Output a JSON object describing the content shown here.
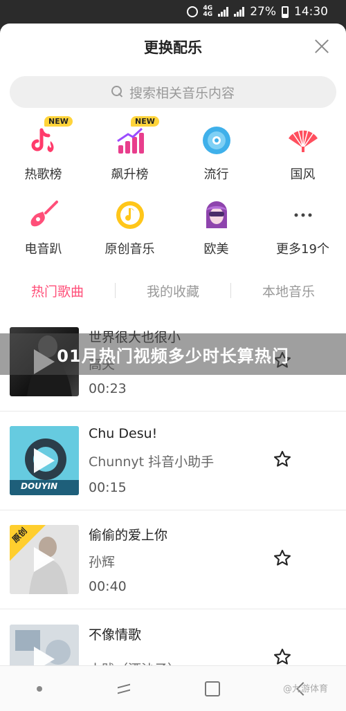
{
  "status_bar": {
    "net1": "4G",
    "net2": "4G",
    "battery": "27%",
    "time": "14:30"
  },
  "header": {
    "title": "更换配乐"
  },
  "search": {
    "placeholder": "搜索相关音乐内容"
  },
  "categories": [
    {
      "label": "热歌榜",
      "icon": "tiktok-fire-icon",
      "badge": "NEW"
    },
    {
      "label": "飙升榜",
      "icon": "trending-bars-icon",
      "badge": "NEW"
    },
    {
      "label": "流行",
      "icon": "vinyl-disc-icon"
    },
    {
      "label": "国风",
      "icon": "folding-fan-icon"
    },
    {
      "label": "电音趴",
      "icon": "electric-guitar-icon"
    },
    {
      "label": "原创音乐",
      "icon": "music-note-disc-icon"
    },
    {
      "label": "欧美",
      "icon": "avatar-sunglasses-icon"
    },
    {
      "label": "更多19个",
      "icon": "more-dots-icon"
    }
  ],
  "tabs": [
    {
      "label": "热门歌曲",
      "active": true
    },
    {
      "label": "我的收藏",
      "active": false
    },
    {
      "label": "本地音乐",
      "active": false
    }
  ],
  "songs": [
    {
      "name": "世界很大也很小",
      "artist": "高夫",
      "duration": "00:23"
    },
    {
      "name": "Chu Desu!",
      "artist": "Chunnyt 抖音小助手",
      "duration": "00:15",
      "cover_text": "DOUYIN"
    },
    {
      "name": "偷偷的爱上你",
      "artist": "孙辉",
      "duration": "00:40",
      "badge": "原创"
    },
    {
      "name": "不像情歌",
      "artist": "小贱（酒沙子）",
      "duration": ""
    }
  ],
  "overlay": {
    "text": "01月热门视频多少时长算热门"
  },
  "watermark": "@九游体育",
  "colors": {
    "accent": "#ff4f79",
    "badge_yellow": "#ffd43b"
  }
}
